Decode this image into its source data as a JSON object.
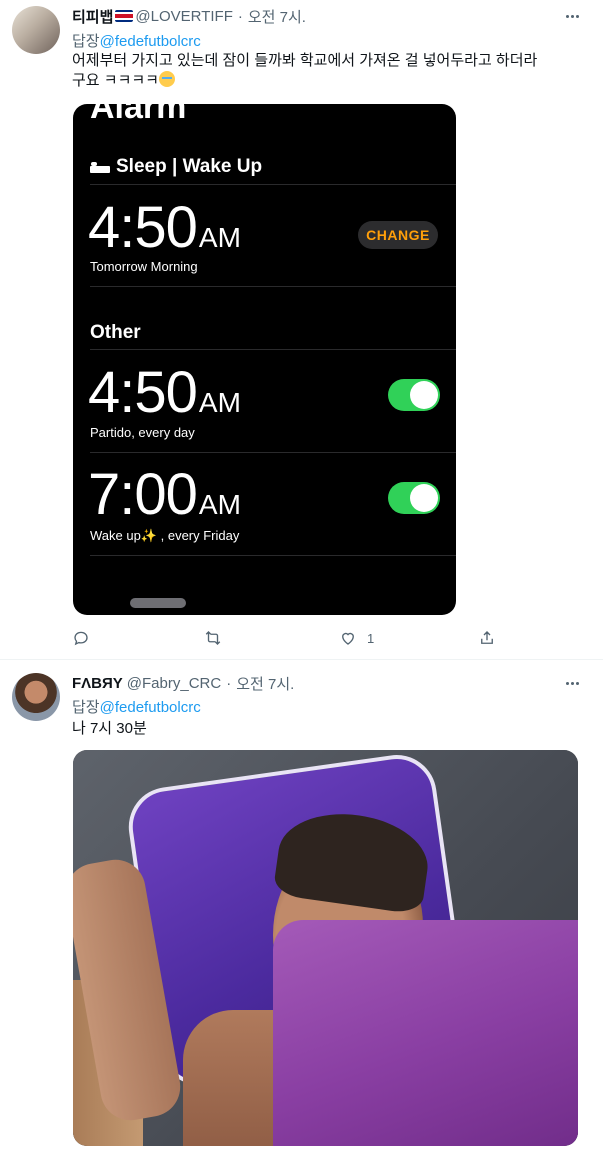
{
  "tweet1": {
    "display_name": "티피뱁",
    "handle": "@LOVERTIFF",
    "dot": "·",
    "time": "오전 7시.",
    "replying_prefix": "답장",
    "replying_to": "@fedefutbolcrc",
    "text_line1": "어제부터 가지고 있는데 잠이 들까봐 학교에서 가져온 걸 넣어두라고 하더라",
    "text_line2": "구요 ㅋㅋㅋㅋ",
    "alarm": {
      "title": "Alarm",
      "sleep_section": "Sleep | Wake Up",
      "sleep_time": "4:50",
      "sleep_ampm": "AM",
      "sleep_label": "Tomorrow Morning",
      "change_label": "CHANGE",
      "other_section": "Other",
      "alarm1_time": "4:50",
      "alarm1_ampm": "AM",
      "alarm1_label": "Partido, every day",
      "alarm1_on": true,
      "alarm2_time": "7:00",
      "alarm2_ampm": "AM",
      "alarm2_label": "Wake up✨ , every Friday",
      "alarm2_on": true
    },
    "actions": {
      "reply_count": "",
      "retweet_count": "",
      "like_count": "1"
    }
  },
  "tweet2": {
    "display_name": "FΛBЯY",
    "handle": "@Fabry_CRC",
    "dot": "·",
    "time": "오전 7시.",
    "replying_prefix": "답장",
    "replying_to": "@fedefutbolcrc",
    "text": "나 7시 30분"
  },
  "colors": {
    "accent": "#1d9bf0",
    "muted": "#536471",
    "toggle_on": "#30d158",
    "change_text": "#ff9f0a"
  }
}
